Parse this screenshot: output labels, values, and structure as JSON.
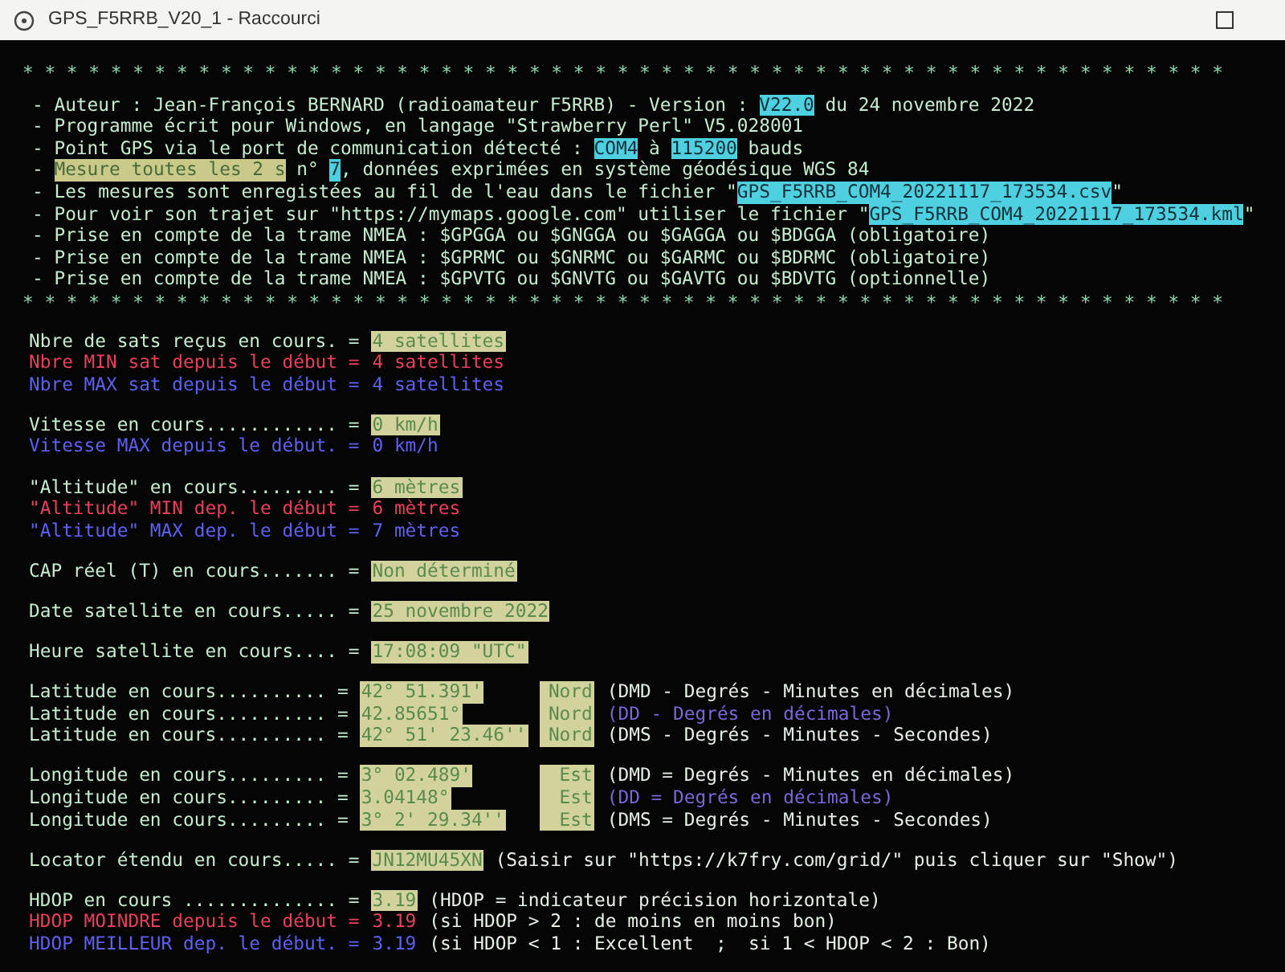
{
  "window": {
    "title": "GPS_F5RRB_V20_1 - Raccourci"
  },
  "header": {
    "border_top": "* * * * * * * * * * * * * * * * * * * * * * * * * * * * * * * * * * * * * * * * * * * * * * * * * * * * * * *",
    "lines": [
      [
        {
          "kind": "text",
          "text": "- Auteur : Jean-François BERNARD (radioamateur F5RRB) - Version : "
        },
        {
          "kind": "cyan",
          "text": "V22.0"
        },
        {
          "kind": "text",
          "text": " du 24 novembre 2022"
        }
      ],
      [
        {
          "kind": "text",
          "text": "- Programme écrit pour Windows, en langage \"Strawberry Perl\" V5.028001"
        }
      ],
      [
        {
          "kind": "text",
          "text": "- Point GPS via le port de communication détecté : "
        },
        {
          "kind": "cyan",
          "text": "COM4"
        },
        {
          "kind": "text",
          "text": " à "
        },
        {
          "kind": "cyan",
          "text": "115200"
        },
        {
          "kind": "text",
          "text": " bauds"
        }
      ],
      [
        {
          "kind": "text",
          "text": "- "
        },
        {
          "kind": "khaki",
          "text": "Mesure toutes les 2 s"
        },
        {
          "kind": "text",
          "text": " n° "
        },
        {
          "kind": "cyan",
          "text": "7"
        },
        {
          "kind": "text",
          "text": ", données exprimées en système géodésique WGS 84"
        }
      ],
      [
        {
          "kind": "text",
          "text": "- Les mesures sont enregistées au fil de l'eau dans le fichier \""
        },
        {
          "kind": "cyan",
          "text": "GPS_F5RRB_COM4_20221117_173534.csv"
        },
        {
          "kind": "text",
          "text": "\""
        }
      ],
      [
        {
          "kind": "text",
          "text": "- Pour voir son trajet sur \"https://mymaps.google.com\" utiliser le fichier \""
        },
        {
          "kind": "cyan",
          "text": "GPS_F5RRB_COM4_20221117_173534.kml"
        },
        {
          "kind": "text",
          "text": "\""
        }
      ],
      [
        {
          "kind": "text",
          "text": "- Prise en compte de la trame NMEA : $GPGGA ou $GNGGA ou $GAGGA ou $BDGGA (obligatoire)"
        }
      ],
      [
        {
          "kind": "text",
          "text": "- Prise en compte de la trame NMEA : $GPRMC ou $GNRMC ou $GARMC ou $BDRMC (obligatoire)"
        }
      ],
      [
        {
          "kind": "text",
          "text": "- Prise en compte de la trame NMEA : $GPVTG ou $GNVTG ou $GAVTG ou $BDVTG (optionnelle)"
        }
      ]
    ],
    "border_bottom": "* * * * * * * * * * * * * * * * * * * * * * * * * * * * * * * * * * * * * * * * * * * * * * * * * * * * * * *"
  },
  "groups": [
    {
      "rows": [
        {
          "label": "Nbre de sats reçus en cours. =",
          "value": "4 satellites",
          "highlighted": true,
          "color": "#c6ecd0"
        },
        {
          "label": "Nbre MIN sat depuis le début =",
          "value": "4 satellites",
          "highlighted": false,
          "color": "#e8405e"
        },
        {
          "label": "Nbre MAX sat depuis le début =",
          "value": "4 satellites",
          "highlighted": false,
          "color": "#6060f0"
        }
      ]
    },
    {
      "rows": [
        {
          "label": "Vitesse en cours............ =",
          "value": "0 km/h",
          "highlighted": true,
          "color": "#c6ecd0"
        },
        {
          "label": "Vitesse MAX depuis le début. =",
          "value": "0 km/h",
          "highlighted": false,
          "color": "#6060f0"
        }
      ]
    },
    {
      "rows": [
        {
          "label": "\"Altitude\" en cours......... =",
          "value": "6 mètres",
          "highlighted": true,
          "color": "#c6ecd0"
        },
        {
          "label": "\"Altitude\" MIN dep. le début =",
          "value": "6 mètres",
          "highlighted": false,
          "color": "#e8405e"
        },
        {
          "label": "\"Altitude\" MAX dep. le début =",
          "value": "7 mètres",
          "highlighted": false,
          "color": "#6060f0"
        }
      ]
    },
    {
      "rows": [
        {
          "label": "CAP réel (T) en cours....... =",
          "value": "Non déterminé",
          "highlighted": true,
          "color": "#c6ecd0"
        }
      ]
    },
    {
      "rows": [
        {
          "label": "Date satellite en cours..... =",
          "value": "25 novembre 2022",
          "highlighted": true,
          "color": "#c6ecd0"
        }
      ]
    },
    {
      "rows": [
        {
          "label": "Heure satellite en cours.... =",
          "value": "17:08:09 \"UTC\"",
          "highlighted": true,
          "color": "#c6ecd0"
        }
      ]
    },
    {
      "rows": [
        {
          "label": "Latitude en cours.......... =",
          "value": "42° 51.391'",
          "highlighted": true,
          "color": "#c6ecd0",
          "direction": "Nord",
          "note": {
            "text": "(DMD - Degrés - Minutes en décimales)",
            "color": "#e6f0e6"
          }
        },
        {
          "label": "Latitude en cours.......... =",
          "value": "42.85651°",
          "highlighted": true,
          "color": "#c6ecd0",
          "direction": "Nord",
          "note": {
            "text": "(DD - Degrés en décimales)",
            "color": "#7a68d8"
          }
        },
        {
          "label": "Latitude en cours.......... =",
          "value": "42° 51' 23.46''",
          "highlighted": true,
          "color": "#c6ecd0",
          "direction": "Nord",
          "note": {
            "text": "(DMS - Degrés - Minutes - Secondes)",
            "color": "#e6f0e6"
          }
        }
      ]
    },
    {
      "rows": [
        {
          "label": "Longitude en cours......... =",
          "value": "3° 02.489'",
          "highlighted": true,
          "color": "#c6ecd0",
          "direction": "Est",
          "note": {
            "text": "(DMD = Degrés - Minutes en décimales)",
            "color": "#e6f0e6"
          }
        },
        {
          "label": "Longitude en cours......... =",
          "value": "3.04148°",
          "highlighted": true,
          "color": "#c6ecd0",
          "direction": "Est",
          "note": {
            "text": "(DD = Degrés en décimales)",
            "color": "#7a68d8"
          }
        },
        {
          "label": "Longitude en cours......... =",
          "value": "3° 2' 29.34''",
          "highlighted": true,
          "color": "#c6ecd0",
          "direction": "Est",
          "note": {
            "text": "(DMS = Degrés - Minutes - Secondes)",
            "color": "#e6f0e6"
          }
        }
      ]
    },
    {
      "rows": [
        {
          "label": "Locator étendu en cours..... =",
          "value": "JN12MU45XN",
          "highlighted": true,
          "color": "#c6ecd0",
          "note": {
            "text": "(Saisir sur \"https://k7fry.com/grid/\" puis cliquer sur \"Show\")",
            "color": "#e6f0e6"
          }
        }
      ]
    },
    {
      "rows": [
        {
          "label": "HDOP en cours .............. =",
          "value": "3.19",
          "highlighted": true,
          "color": "#c6ecd0",
          "note": {
            "text": "(HDOP = indicateur précision horizontale)",
            "color": "#e6f0e6"
          }
        },
        {
          "label": "HDOP MOINDRE depuis le début =",
          "value": "3.19",
          "highlighted": false,
          "color": "#e8405e",
          "note": {
            "text": "(si HDOP > 2 : de moins en moins bon)",
            "color": "#e6f0e6"
          }
        },
        {
          "label": "HDOP MEILLEUR dep. le début. =",
          "value": "3.19",
          "highlighted": false,
          "color": "#6060f0",
          "note": {
            "text": "(si HDOP < 1 : Excellent  ;  si 1 < HDOP < 2 : Bon)",
            "color": "#e6f0e6"
          }
        }
      ]
    }
  ]
}
